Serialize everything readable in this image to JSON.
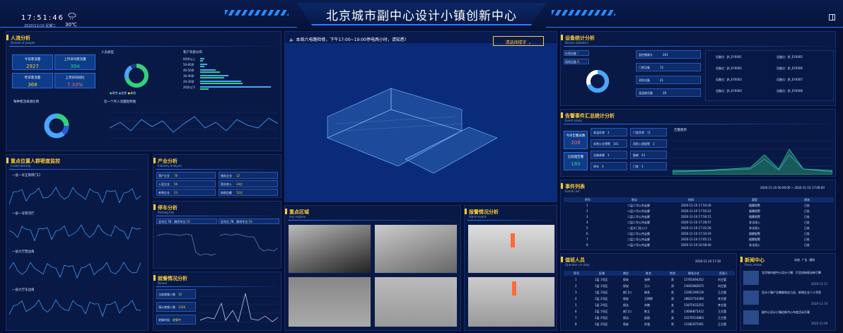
{
  "header": {
    "title": "北京城市副中心设计小镇创新中心",
    "time": "17:51:46",
    "date": "2020/11/10   星期二",
    "temperature": "30℃",
    "weather_icon": "cloud-rain-icon",
    "exit_icon": "exit-icon"
  },
  "people": {
    "title": "人流分析",
    "subtitle": "Stream of people",
    "metrics": [
      {
        "label": "今日客流量",
        "value": "2927"
      },
      {
        "label": "上月日均客流量",
        "value": "394"
      },
      {
        "label": "昨日客流量",
        "value": "368"
      },
      {
        "label": "上月日均同比",
        "value": "7.33%"
      }
    ],
    "gender_label": "人员类型",
    "gender_legend": [
      "男性",
      "女性",
      "其他"
    ],
    "age_label": "客户年龄分布",
    "age_bars": [
      {
        "label": "60岁以上",
        "v1": 6,
        "v2": 4
      },
      {
        "label": "50-60岁",
        "v1": 10,
        "v2": 6
      },
      {
        "label": "40-50岁",
        "v1": 22,
        "v2": 28
      },
      {
        "label": "30-40岁",
        "v1": 40,
        "v2": 34
      },
      {
        "label": "20-30岁",
        "v1": 58,
        "v2": 60
      },
      {
        "label": "20岁以下",
        "v1": 100,
        "v2": 12
      }
    ],
    "source_label": "每种客流来源比例",
    "trend_label": "近一个月人流量趋势图"
  },
  "crowd": {
    "title": "重点位置人群密度监控",
    "subtitle": "Crowd density",
    "rows": [
      "一层一号正南侧门口",
      "一层一号客流厅",
      "一层大厅西边角",
      "一层大厅东边角"
    ]
  },
  "industry": {
    "title": "产业分析",
    "subtitle": "Industry analysis",
    "items": [
      {
        "label": "落户企业",
        "value": "78"
      },
      {
        "label": "入驻企业",
        "value": "56"
      },
      {
        "label": "新增企业",
        "value": "23"
      },
      {
        "label": "服务企业",
        "value": "12"
      },
      {
        "label": "营业收入",
        "value": "34亿"
      },
      {
        "label": "纳税总额",
        "value": "12亿"
      }
    ]
  },
  "parking": {
    "title": "停车分析",
    "subtitle": "Parking lots",
    "left_total": "总车位",
    "left_free": "剩余车位",
    "right_total": "总车位",
    "right_free": "剩余车位",
    "left_total_value": "76",
    "left_free_value": "19",
    "right_total_value": "76",
    "right_free_value": "19"
  },
  "driver": {
    "title": "就餐情况分析",
    "subtitle": "Dinner",
    "items": [
      {
        "label": "当前就餐人数",
        "value": "19"
      },
      {
        "label": "预计就餐人数",
        "value": "1326"
      },
      {
        "label": "就餐时段",
        "value": "就餐中"
      }
    ]
  },
  "notice": {
    "text": "本周六电路检修，下午17:00~19:00停电两小时，请知悉！",
    "select_label": "请选择楼宇"
  },
  "key_areas": {
    "title": "重点区域",
    "subtitle": "key regions"
  },
  "alarm": {
    "title": "报警情况分析",
    "subtitle": "Alarm event"
  },
  "device": {
    "title": "设备统计分析",
    "subtitle": "Device statistics",
    "status": [
      {
        "label": "在线设备",
        "value": "7"
      },
      {
        "label": "离线设备",
        "value": "8"
      }
    ],
    "categories": [
      {
        "label": "监控摄像头",
        "value": "261"
      },
      {
        "label": "门禁设备",
        "value": "12"
      },
      {
        "label": "消防设备",
        "value": "41"
      },
      {
        "label": "温湿度设备",
        "value": "28"
      }
    ],
    "codes": [
      "设备位：JK_EY0001",
      "设备位：JK_EY0002",
      "设备位：JK_EY0003",
      "设备位：JK_EY0004",
      "设备位：JK_EY0005",
      "设备位：JK_EY0006",
      "设备位：JK_EY0007",
      "设备位：JK_EY0008"
    ]
  },
  "events": {
    "title": "告警事件汇总统计分析",
    "subtitle": "Event study",
    "total_label": "今日告警总数",
    "total_value": "208",
    "done_label": "已处理告警",
    "done_value": "180",
    "items": [
      {
        "label": "高温异常",
        "value": "3"
      },
      {
        "label": "门禁异常",
        "value": "11"
      },
      {
        "label": "非常火灾预警",
        "value": "101"
      },
      {
        "label": "消防入侵报警",
        "value": "3"
      },
      {
        "label": "设备故障",
        "value": "3"
      },
      {
        "label": "烟感",
        "value": "43"
      },
      {
        "label": "停车",
        "value": "4"
      },
      {
        "label": "门禁",
        "value": "3"
      }
    ],
    "chart_label": "告警趋势"
  },
  "event_list": {
    "title": "事件列表",
    "subtitle": "Events list",
    "date_from": "2020-11-10 00:00:00",
    "date_to": "2020-11-10 17:00:00",
    "columns": [
      "序号",
      "地点",
      "时间",
      "类型",
      "状态"
    ],
    "rows": [
      {
        "n": "1",
        "place": "二层二号公共走廊",
        "time": "2020-11-10 17:50:26",
        "type": "烟雾报警",
        "state": "已处"
      },
      {
        "n": "2",
        "place": "二层二号公共走廊",
        "time": "2020-11-10 17:50:22",
        "type": "烟雾报警",
        "state": "已处"
      },
      {
        "n": "3",
        "place": "二层二号公共走廊",
        "time": "2020-11-10 17:50:15",
        "type": "烟雾报警",
        "state": "已处"
      },
      {
        "n": "4",
        "place": "二层二号公共走廊",
        "time": "2020-11-10 17:28:57",
        "type": "非法闯入",
        "state": "已处"
      },
      {
        "n": "5",
        "place": "一层大门北入口",
        "time": "2020-11-10 17:22:26",
        "type": "非法闯入",
        "state": "已处"
      },
      {
        "n": "6",
        "place": "二层二号公共走廊",
        "time": "2020-11-10 17:10:19",
        "type": "烟雾报警",
        "state": "已处"
      },
      {
        "n": "7",
        "place": "二层二号公共走廊",
        "time": "2020-11-10 17:05:13",
        "type": "烟雾报警",
        "state": "已处"
      },
      {
        "n": "8",
        "place": "二层二号公共走廊",
        "time": "2020-11-10 16:58:40",
        "type": "非法闯入",
        "state": "已处"
      }
    ]
  },
  "staff": {
    "title": "值班人员",
    "subtitle": "Operator on duty",
    "date": "2020-11-10 17:30",
    "columns": [
      "序号",
      "区域",
      "岗位",
      "姓名",
      "性别",
      "联系方式",
      "负责人"
    ],
    "rows": [
      {
        "n": "1",
        "area": "1层 1号区",
        "post": "保安",
        "name": "张明",
        "sex": "男",
        "phone": "15765094352",
        "lead": "刘主管"
      },
      {
        "n": "2",
        "area": "1层 1号区",
        "post": "保安",
        "name": "王小",
        "sex": "男",
        "phone": "13603482675",
        "lead": "刘主管"
      },
      {
        "n": "3",
        "area": "1层 1号区",
        "post": "前门口",
        "name": "杨亮",
        "sex": "男",
        "phone": "13281346126",
        "lead": "王主管"
      },
      {
        "n": "4",
        "area": "1层 2号区",
        "post": "保安",
        "name": "王明晖",
        "sex": "男",
        "phone": "18823716390",
        "lead": "李主管"
      },
      {
        "n": "5",
        "area": "1层 2号区",
        "post": "保洁",
        "name": "刘晓",
        "sex": "女",
        "phone": "15875433252",
        "lead": "李主管"
      },
      {
        "n": "6",
        "area": "2层 1号区",
        "post": "前门口",
        "name": "陈立",
        "sex": "男",
        "phone": "13608875412",
        "lead": "王主管"
      },
      {
        "n": "7",
        "area": "2层 2号区",
        "post": "保洁",
        "name": "赵丽",
        "sex": "女",
        "phone": "15276533863",
        "lead": "王主管"
      },
      {
        "n": "8",
        "area": "2层 2号区",
        "post": "保安",
        "name": "孙强",
        "sex": "男",
        "phone": "13182475561",
        "lead": "王主管"
      }
    ]
  },
  "news": {
    "title": "新闻中心",
    "subtitle": "Press center",
    "tabs": [
      "动态",
      "广告",
      "通知"
    ],
    "items": [
      {
        "headline": "北京城市副中心设计小镇：打造创新驱动新引擎",
        "date": "2020-11-11"
      },
      {
        "headline": "设计小镇产业集聚效应凸显，新增企业二十余家",
        "date": "2020-11-10"
      },
      {
        "headline": "副中心设计小镇创新中心年度活动开幕",
        "date": "2020-11-09"
      }
    ]
  },
  "colors": {
    "accent": "#ffcc33",
    "primary": "#2f7bff",
    "green": "#33d17a",
    "background": "#061033"
  }
}
